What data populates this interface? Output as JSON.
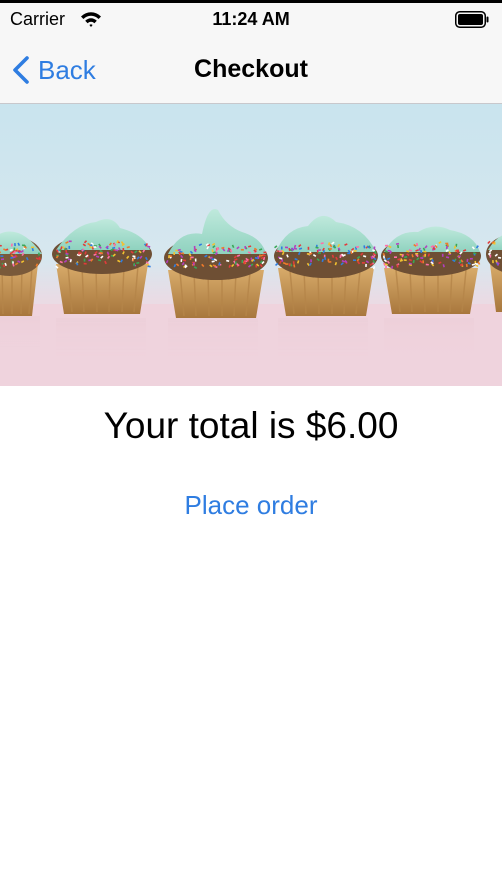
{
  "status_bar": {
    "carrier": "Carrier",
    "time": "11:24 AM",
    "wifi_icon": "wifi-icon",
    "battery_icon": "battery-icon"
  },
  "nav": {
    "back_label": "Back",
    "title": "Checkout",
    "back_icon": "chevron-left-icon"
  },
  "hero": {
    "description_icon": "cupcakes-photo"
  },
  "checkout": {
    "total_text": "Your total is $6.00",
    "place_order_label": "Place order"
  },
  "colors": {
    "accent": "#2f7de1",
    "bar_background": "#f7f7f7",
    "frosting": "#a8dccc",
    "cake": "#c99a5a"
  }
}
